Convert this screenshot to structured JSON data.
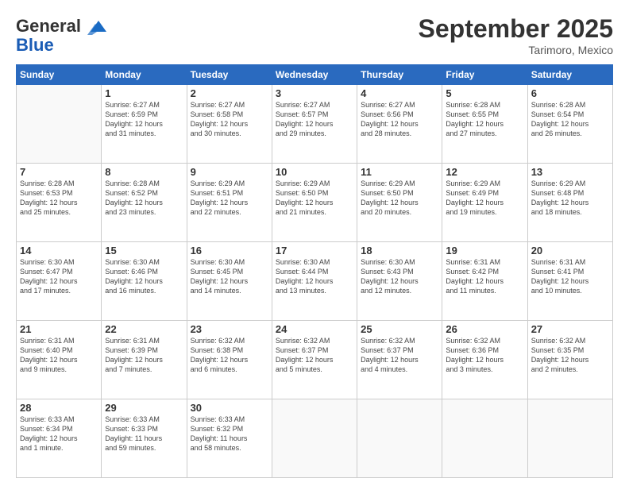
{
  "header": {
    "logo_line1": "General",
    "logo_line2": "Blue",
    "month": "September 2025",
    "location": "Tarimoro, Mexico"
  },
  "weekdays": [
    "Sunday",
    "Monday",
    "Tuesday",
    "Wednesday",
    "Thursday",
    "Friday",
    "Saturday"
  ],
  "weeks": [
    [
      {
        "day": "",
        "info": ""
      },
      {
        "day": "1",
        "info": "Sunrise: 6:27 AM\nSunset: 6:59 PM\nDaylight: 12 hours\nand 31 minutes."
      },
      {
        "day": "2",
        "info": "Sunrise: 6:27 AM\nSunset: 6:58 PM\nDaylight: 12 hours\nand 30 minutes."
      },
      {
        "day": "3",
        "info": "Sunrise: 6:27 AM\nSunset: 6:57 PM\nDaylight: 12 hours\nand 29 minutes."
      },
      {
        "day": "4",
        "info": "Sunrise: 6:27 AM\nSunset: 6:56 PM\nDaylight: 12 hours\nand 28 minutes."
      },
      {
        "day": "5",
        "info": "Sunrise: 6:28 AM\nSunset: 6:55 PM\nDaylight: 12 hours\nand 27 minutes."
      },
      {
        "day": "6",
        "info": "Sunrise: 6:28 AM\nSunset: 6:54 PM\nDaylight: 12 hours\nand 26 minutes."
      }
    ],
    [
      {
        "day": "7",
        "info": "Sunrise: 6:28 AM\nSunset: 6:53 PM\nDaylight: 12 hours\nand 25 minutes."
      },
      {
        "day": "8",
        "info": "Sunrise: 6:28 AM\nSunset: 6:52 PM\nDaylight: 12 hours\nand 23 minutes."
      },
      {
        "day": "9",
        "info": "Sunrise: 6:29 AM\nSunset: 6:51 PM\nDaylight: 12 hours\nand 22 minutes."
      },
      {
        "day": "10",
        "info": "Sunrise: 6:29 AM\nSunset: 6:50 PM\nDaylight: 12 hours\nand 21 minutes."
      },
      {
        "day": "11",
        "info": "Sunrise: 6:29 AM\nSunset: 6:50 PM\nDaylight: 12 hours\nand 20 minutes."
      },
      {
        "day": "12",
        "info": "Sunrise: 6:29 AM\nSunset: 6:49 PM\nDaylight: 12 hours\nand 19 minutes."
      },
      {
        "day": "13",
        "info": "Sunrise: 6:29 AM\nSunset: 6:48 PM\nDaylight: 12 hours\nand 18 minutes."
      }
    ],
    [
      {
        "day": "14",
        "info": "Sunrise: 6:30 AM\nSunset: 6:47 PM\nDaylight: 12 hours\nand 17 minutes."
      },
      {
        "day": "15",
        "info": "Sunrise: 6:30 AM\nSunset: 6:46 PM\nDaylight: 12 hours\nand 16 minutes."
      },
      {
        "day": "16",
        "info": "Sunrise: 6:30 AM\nSunset: 6:45 PM\nDaylight: 12 hours\nand 14 minutes."
      },
      {
        "day": "17",
        "info": "Sunrise: 6:30 AM\nSunset: 6:44 PM\nDaylight: 12 hours\nand 13 minutes."
      },
      {
        "day": "18",
        "info": "Sunrise: 6:30 AM\nSunset: 6:43 PM\nDaylight: 12 hours\nand 12 minutes."
      },
      {
        "day": "19",
        "info": "Sunrise: 6:31 AM\nSunset: 6:42 PM\nDaylight: 12 hours\nand 11 minutes."
      },
      {
        "day": "20",
        "info": "Sunrise: 6:31 AM\nSunset: 6:41 PM\nDaylight: 12 hours\nand 10 minutes."
      }
    ],
    [
      {
        "day": "21",
        "info": "Sunrise: 6:31 AM\nSunset: 6:40 PM\nDaylight: 12 hours\nand 9 minutes."
      },
      {
        "day": "22",
        "info": "Sunrise: 6:31 AM\nSunset: 6:39 PM\nDaylight: 12 hours\nand 7 minutes."
      },
      {
        "day": "23",
        "info": "Sunrise: 6:32 AM\nSunset: 6:38 PM\nDaylight: 12 hours\nand 6 minutes."
      },
      {
        "day": "24",
        "info": "Sunrise: 6:32 AM\nSunset: 6:37 PM\nDaylight: 12 hours\nand 5 minutes."
      },
      {
        "day": "25",
        "info": "Sunrise: 6:32 AM\nSunset: 6:37 PM\nDaylight: 12 hours\nand 4 minutes."
      },
      {
        "day": "26",
        "info": "Sunrise: 6:32 AM\nSunset: 6:36 PM\nDaylight: 12 hours\nand 3 minutes."
      },
      {
        "day": "27",
        "info": "Sunrise: 6:32 AM\nSunset: 6:35 PM\nDaylight: 12 hours\nand 2 minutes."
      }
    ],
    [
      {
        "day": "28",
        "info": "Sunrise: 6:33 AM\nSunset: 6:34 PM\nDaylight: 12 hours\nand 1 minute."
      },
      {
        "day": "29",
        "info": "Sunrise: 6:33 AM\nSunset: 6:33 PM\nDaylight: 11 hours\nand 59 minutes."
      },
      {
        "day": "30",
        "info": "Sunrise: 6:33 AM\nSunset: 6:32 PM\nDaylight: 11 hours\nand 58 minutes."
      },
      {
        "day": "",
        "info": ""
      },
      {
        "day": "",
        "info": ""
      },
      {
        "day": "",
        "info": ""
      },
      {
        "day": "",
        "info": ""
      }
    ]
  ]
}
